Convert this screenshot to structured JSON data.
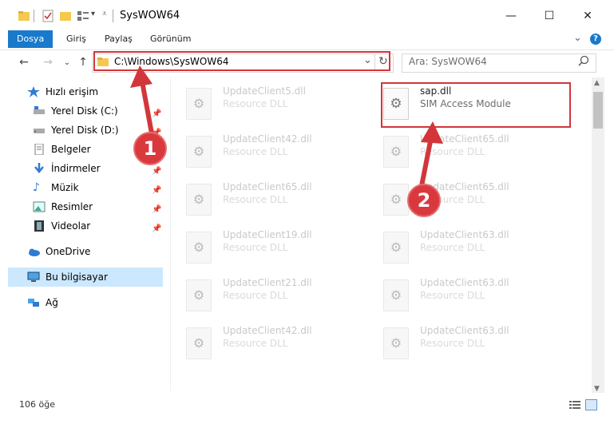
{
  "window": {
    "title": "SysWOW64",
    "minimize_glyph": "—",
    "maximize_glyph": "☐",
    "close_glyph": "✕"
  },
  "ribbon": {
    "tabs": [
      "Dosya",
      "Giriş",
      "Paylaş",
      "Görünüm"
    ],
    "help_glyph": "?",
    "collapse_glyph": "⌄"
  },
  "address": {
    "path": "C:\\Windows\\SysWOW64",
    "refresh_glyph": "↻",
    "dropdown_glyph": "⌄"
  },
  "search": {
    "placeholder": "Ara: SysWOW64",
    "icon": "search-icon"
  },
  "sidebar": {
    "items": [
      {
        "label": "Hızlı erişim",
        "icon": "star-icon"
      },
      {
        "label": "Yerel Disk (C:)",
        "icon": "drive-icon"
      },
      {
        "label": "Yerel Disk (D:)",
        "icon": "drive-icon"
      },
      {
        "label": "Belgeler",
        "icon": "documents-icon"
      },
      {
        "label": "İndirmeler",
        "icon": "download-icon"
      },
      {
        "label": "Müzik",
        "icon": "music-icon"
      },
      {
        "label": "Resimler",
        "icon": "pictures-icon"
      },
      {
        "label": "Videolar",
        "icon": "video-icon"
      },
      {
        "label": "OneDrive",
        "icon": "cloud-icon"
      },
      {
        "label": "Bu bilgisayar",
        "icon": "computer-icon"
      },
      {
        "label": "Ağ",
        "icon": "network-icon"
      }
    ]
  },
  "files": {
    "left_column": [
      {
        "name": "UpdateClient5.dll",
        "desc": "Resource DLL"
      },
      {
        "name": "UpdateClient42.dll",
        "desc": "Resource DLL"
      },
      {
        "name": "UpdateClient65.dll",
        "desc": "Resource DLL"
      },
      {
        "name": "UpdateClient19.dll",
        "desc": "Resource DLL"
      },
      {
        "name": "UpdateClient21.dll",
        "desc": "Resource DLL"
      },
      {
        "name": "UpdateClient42.dll",
        "desc": "Resource DLL"
      }
    ],
    "right_column": [
      {
        "name": "sap.dll",
        "desc": "SIM Access Module"
      },
      {
        "name": "UpdateClient65.dll",
        "desc": "Resource DLL"
      },
      {
        "name": "UpdateClient65.dll",
        "desc": "Resource DLL"
      },
      {
        "name": "UpdateClient63.dll",
        "desc": "Resource DLL"
      },
      {
        "name": "UpdateClient63.dll",
        "desc": "Resource DLL"
      },
      {
        "name": "UpdateClient63.dll",
        "desc": "Resource DLL"
      }
    ]
  },
  "status": {
    "count": "106 öğe"
  },
  "annotations": {
    "step1": "1",
    "step2": "2",
    "color": "#d2363b"
  }
}
